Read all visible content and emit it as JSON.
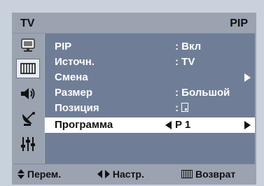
{
  "header": {
    "source": "TV",
    "menu_title": "PIP"
  },
  "sidebar": {
    "icons": [
      {
        "name": "picture-icon"
      },
      {
        "name": "pip-menu-icon",
        "active": true
      },
      {
        "name": "sound-icon"
      },
      {
        "name": "channel-icon"
      },
      {
        "name": "setup-icon"
      }
    ]
  },
  "menu": {
    "rows": [
      {
        "label": "PIP",
        "value": ": Вкл"
      },
      {
        "label": "Источн.",
        "value": ": TV"
      },
      {
        "label": "Смена",
        "value": ""
      },
      {
        "label": "Размер",
        "value": ": Большой"
      },
      {
        "label": "Позиция",
        "value": ":"
      },
      {
        "label": "Программа",
        "value": "P 1",
        "selected": true
      }
    ]
  },
  "footer": {
    "move": "Перем.",
    "adjust": "Настр.",
    "return": "Возврат"
  },
  "colors": {
    "menu_bg": "#6f7e96",
    "chrome": "#9ba2b0",
    "selected_bg": "#ffffff"
  }
}
